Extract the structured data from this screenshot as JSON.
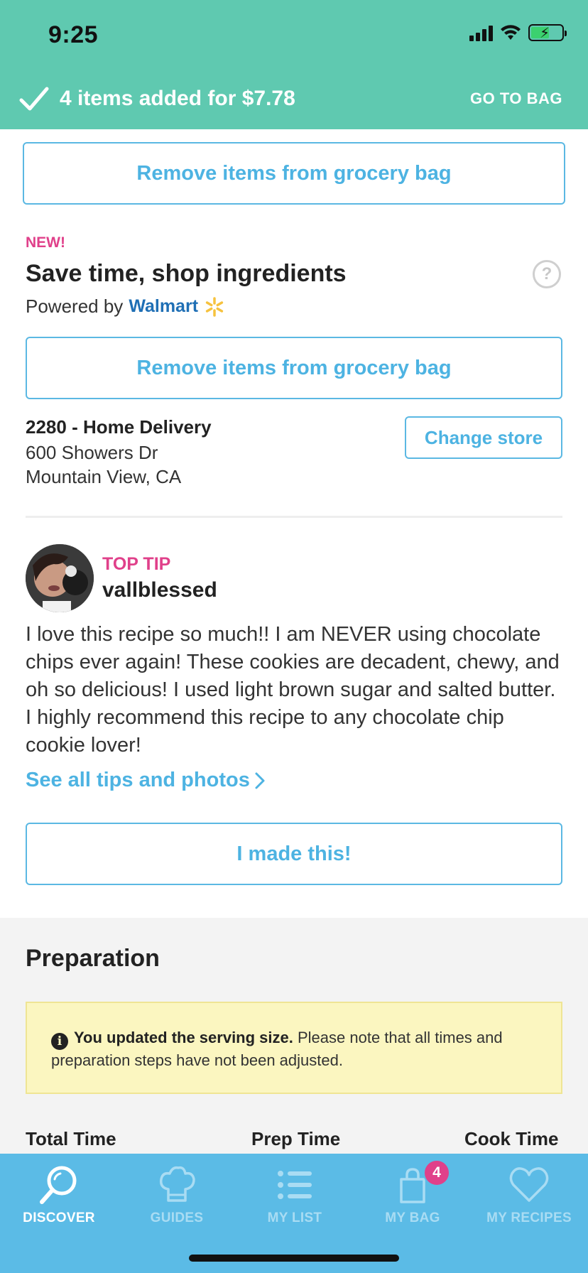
{
  "status_bar": {
    "time": "9:25"
  },
  "banner": {
    "added_text": "4 items added for $7.78",
    "go_to_bag": "GO TO BAG"
  },
  "remove_button_1": "Remove items from grocery bag",
  "shop": {
    "new_label": "NEW!",
    "title": "Save time, shop ingredients",
    "powered_by": "Powered by",
    "brand": "Walmart",
    "help_glyph": "?",
    "remove_button": "Remove items from grocery bag"
  },
  "store": {
    "name": "2280 - Home Delivery",
    "address_line1": "600 Showers Dr",
    "address_line2": "Mountain View, CA",
    "change_button": "Change store"
  },
  "tip": {
    "label": "TOP TIP",
    "user": "vallblessed",
    "body": "I love this recipe so much!! I am NEVER using chocolate chips ever again! These cookies are decadent, chewy, and oh so delicious! I used light brown sugar and salted butter. I highly recommend this recipe to any chocolate chip cookie lover!",
    "see_all": "See all tips and photos",
    "made_this": "I made this!"
  },
  "preparation": {
    "title": "Preparation",
    "notice_bold": "You updated the serving size.",
    "notice_text": "Please note that all times and preparation steps have not been adjusted.",
    "total_time": "Total Time",
    "prep_time": "Prep Time",
    "cook_time": "Cook Time"
  },
  "nav": {
    "items": [
      {
        "label": "DISCOVER",
        "icon": "search-icon",
        "active": true
      },
      {
        "label": "GUIDES",
        "icon": "chef-hat-icon",
        "active": false
      },
      {
        "label": "MY LIST",
        "icon": "list-icon",
        "active": false
      },
      {
        "label": "MY BAG",
        "icon": "bag-icon",
        "active": false
      },
      {
        "label": "MY RECIPES",
        "icon": "heart-icon",
        "active": false
      }
    ],
    "bag_count": "4"
  },
  "colors": {
    "banner": "#5fc9b0",
    "accent_blue": "#4db3e2",
    "pink": "#e0408a",
    "nav_bg": "#5bbbe6",
    "notice_bg": "#fbf6c0"
  }
}
